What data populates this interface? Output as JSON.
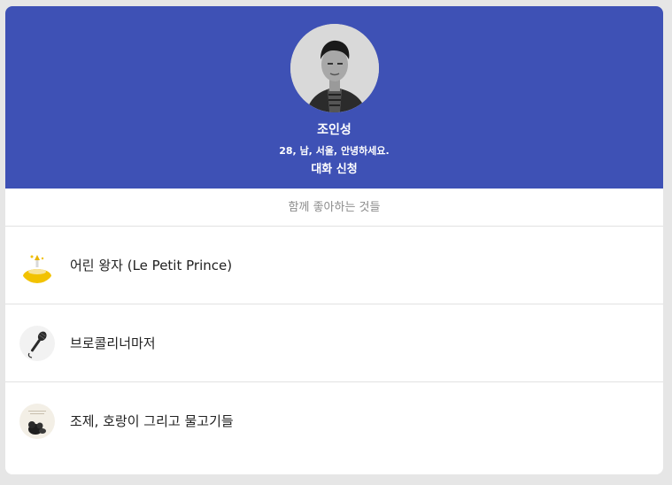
{
  "profile": {
    "name": "조인성",
    "info": "28, 남, 서울, 안녕하세요.",
    "chat_button": "대화 신청",
    "header_color": "#3e51b5"
  },
  "likes": {
    "title": "함께 좋아하는 것들",
    "items": [
      {
        "label": "어린 왕자 (Le Petit Prince)",
        "icon": "book-cover-thumbnail"
      },
      {
        "label": "브로콜리너마저",
        "icon": "microphone-icon"
      },
      {
        "label": "조제, 호랑이 그리고 물고기들",
        "icon": "movie-poster-thumbnail"
      }
    ]
  }
}
